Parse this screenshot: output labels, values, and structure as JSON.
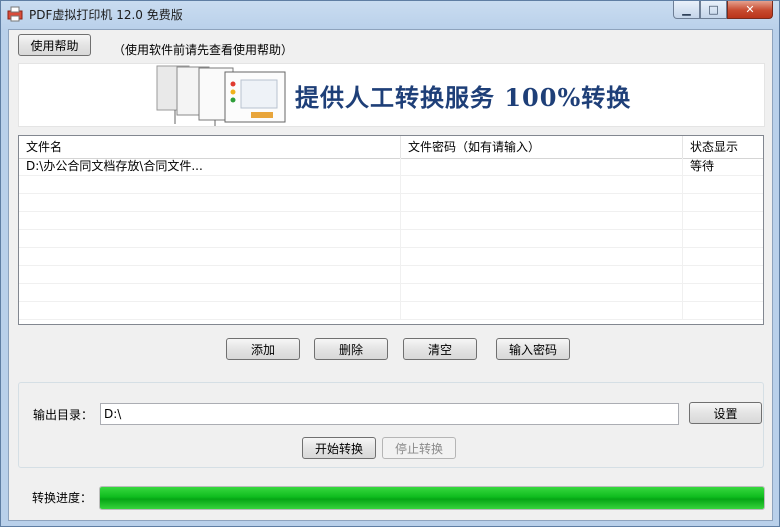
{
  "window": {
    "title": "PDF虚拟打印机 12.0 免费版",
    "icon": "pdf-printer-icon"
  },
  "caption_buttons": {
    "minimize": "minimize-icon",
    "maximize": "maximize-icon",
    "close": "close-icon"
  },
  "toolbar": {
    "help_button": "使用帮助",
    "help_note": "（使用软件前请先查看使用帮助）"
  },
  "banner": {
    "text": "提供人工转换服务 100%转换"
  },
  "table": {
    "columns": [
      "文件名",
      "文件密码（如有请输入）",
      "状态显示"
    ],
    "rows": [
      {
        "file": "D:\\办公合同文档存放\\合同文件...",
        "password": "",
        "status": "等待"
      }
    ]
  },
  "actions": {
    "add": "添加",
    "delete": "删除",
    "clear": "清空",
    "password": "输入密码"
  },
  "output": {
    "label": "输出目录：",
    "path": "D:\\",
    "set_button": "设置",
    "start": "开始转换",
    "stop": "停止转换"
  },
  "progress": {
    "label": "转换进度：",
    "value": 1.0,
    "color": "#0fbc1e"
  }
}
